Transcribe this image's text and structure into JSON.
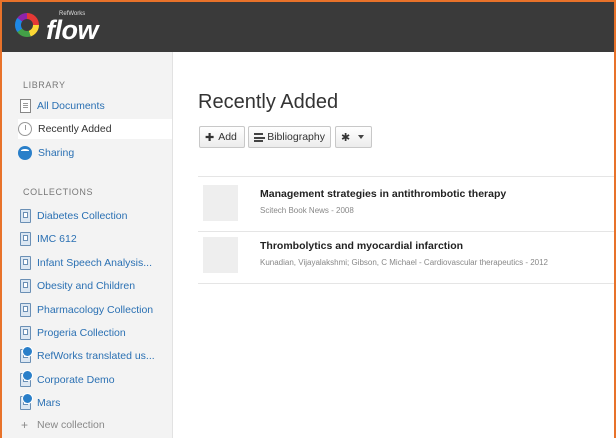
{
  "header": {
    "logo_small": "RefWorks",
    "logo_text": "flow"
  },
  "sidebar": {
    "library_title": "LIBRARY",
    "library_items": [
      {
        "label": "All Documents",
        "icon": "document-icon"
      },
      {
        "label": "Recently Added",
        "icon": "clock-icon",
        "active": true
      },
      {
        "label": "Sharing",
        "icon": "share-icon"
      }
    ],
    "collections_title": "COLLECTIONS",
    "collections": [
      {
        "label": "Diabetes Collection",
        "shared": false
      },
      {
        "label": "IMC 612",
        "shared": false
      },
      {
        "label": "Infant Speech Analysis...",
        "shared": false
      },
      {
        "label": "Obesity and Children",
        "shared": false
      },
      {
        "label": "Pharmacology Collection",
        "shared": false
      },
      {
        "label": "Progeria Collection",
        "shared": false
      },
      {
        "label": "RefWorks translated us...",
        "shared": true
      },
      {
        "label": "Corporate Demo",
        "shared": true
      },
      {
        "label": "Mars",
        "shared": true
      }
    ],
    "new_collection": "New collection",
    "new_collection_icon": "+"
  },
  "main": {
    "title": "Recently Added",
    "toolbar": {
      "add_label": "Add",
      "add_icon": "✚",
      "bibliography_label": "Bibliography",
      "gear_icon": "✱"
    },
    "documents": [
      {
        "title": "Management strategies in antithrombotic therapy",
        "meta": "Scitech Book News - 2008"
      },
      {
        "title": "Thrombolytics and myocardial infarction",
        "meta": "Kunadian, Vijayalakshmi; Gibson, C Michael - Cardiovascular therapeutics - 2012"
      }
    ]
  },
  "colors": {
    "accent": "#2a70b3",
    "frame": "#e8722a",
    "topbar": "#3a3a3a"
  }
}
